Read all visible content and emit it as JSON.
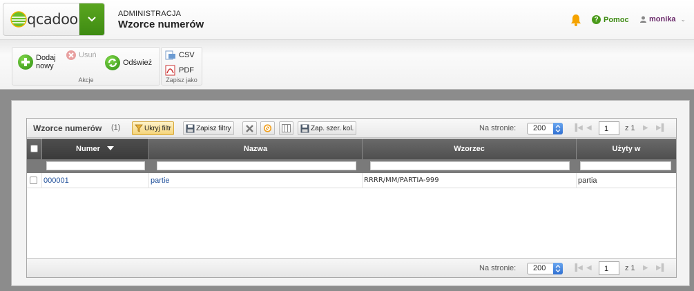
{
  "app": {
    "logo_text": "qcadoo"
  },
  "header": {
    "section": "ADMINISTRACJA",
    "title": "Wzorce numerów",
    "help_label": "Pomoc",
    "user_name": "monika"
  },
  "ribbon": {
    "groups": [
      {
        "label": "Akcje",
        "buttons": [
          {
            "label_l1": "Dodaj",
            "label_l2": "nowy"
          },
          {
            "label": "Usuń"
          },
          {
            "label": "Odśwież"
          }
        ]
      },
      {
        "label": "Zapisz jako",
        "buttons": [
          {
            "label": "CSV"
          },
          {
            "label": "PDF"
          }
        ]
      }
    ]
  },
  "grid": {
    "title": "Wzorce numerów",
    "count": "(1)",
    "toolbar": {
      "hide_filter": "Ukryj filtr",
      "save_filters": "Zapisz filtry",
      "save_col_width": "Zap. szer. kol."
    },
    "pagination": {
      "per_page_label": "Na stronie:",
      "per_page": "200",
      "page": "1",
      "of_label": "z 1"
    },
    "columns": [
      "Numer",
      "Nazwa",
      "Wzorzec",
      "Użyty w"
    ],
    "rows": [
      {
        "numer": "000001",
        "nazwa": "partie",
        "wzorzec": "RRRR/MM/PARTIA-999",
        "uzyty_w": "partia"
      }
    ]
  },
  "colors": {
    "accent_green": "#3d8a12",
    "header_dark": "#555555",
    "link": "#1f4f9a"
  }
}
